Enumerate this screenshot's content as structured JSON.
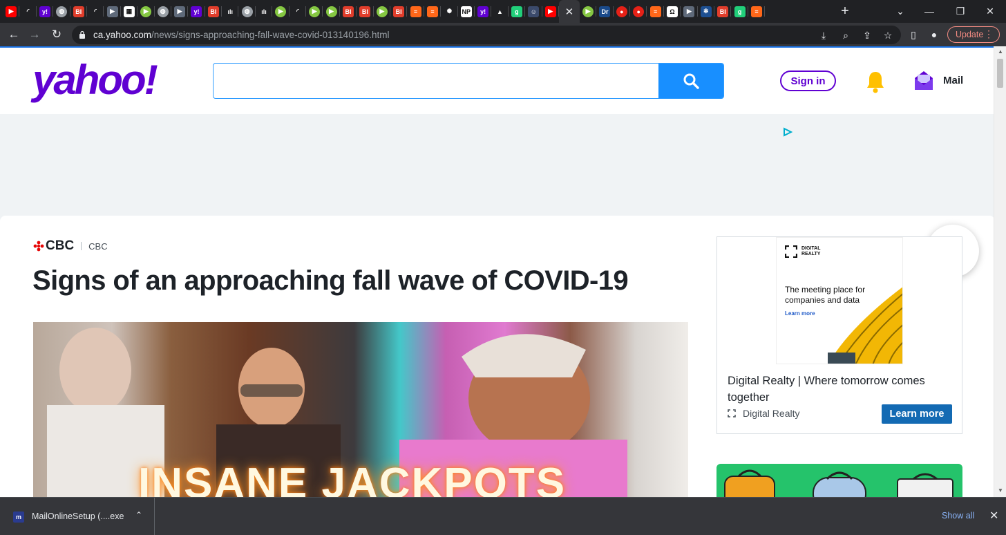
{
  "browser": {
    "tab_icons": [
      {
        "icon": "youtube-icon",
        "bg": "#ff0000",
        "glyph": "▶",
        "circle": false
      },
      {
        "icon": "shield-icon",
        "bg": "#202124",
        "glyph": "◜",
        "circle": false
      },
      {
        "icon": "yahoo-icon",
        "bg": "#6001d2",
        "glyph": "y!",
        "circle": false
      },
      {
        "icon": "globe-icon",
        "bg": "#9aa0a6",
        "glyph": "◍",
        "circle": true
      },
      {
        "icon": "business-insider-icon",
        "bg": "#e13d2b",
        "glyph": "BI",
        "circle": false
      },
      {
        "icon": "shield-icon",
        "bg": "#202124",
        "glyph": "◜",
        "circle": false
      },
      {
        "icon": "arrow-icon",
        "bg": "#5f6a7a",
        "glyph": "▶",
        "circle": false
      },
      {
        "icon": "grid-icon",
        "bg": "#ffffff",
        "glyph": "▦",
        "circle": false
      },
      {
        "icon": "rumble-icon",
        "bg": "#85c742",
        "glyph": "▶",
        "circle": true
      },
      {
        "icon": "globe-icon",
        "bg": "#9aa0a6",
        "glyph": "◍",
        "circle": true
      },
      {
        "icon": "arrow-icon",
        "bg": "#5f6a7a",
        "glyph": "▶",
        "circle": false
      },
      {
        "icon": "yahoo-icon",
        "bg": "#6001d2",
        "glyph": "y!",
        "circle": false
      },
      {
        "icon": "business-insider-icon",
        "bg": "#e13d2b",
        "glyph": "BI",
        "circle": false
      },
      {
        "icon": "bars-icon",
        "bg": "#202124",
        "glyph": "ılı",
        "circle": false
      },
      {
        "icon": "globe-icon",
        "bg": "#9aa0a6",
        "glyph": "◍",
        "circle": true
      },
      {
        "icon": "bars-icon",
        "bg": "#202124",
        "glyph": "ılı",
        "circle": false
      },
      {
        "icon": "rumble-icon",
        "bg": "#85c742",
        "glyph": "▶",
        "circle": true
      },
      {
        "icon": "shield-icon",
        "bg": "#202124",
        "glyph": "◜",
        "circle": false
      },
      {
        "icon": "rumble-icon",
        "bg": "#85c742",
        "glyph": "▶",
        "circle": true
      },
      {
        "icon": "rumble-icon",
        "bg": "#85c742",
        "glyph": "▶",
        "circle": true
      },
      {
        "icon": "business-insider-icon",
        "bg": "#e13d2b",
        "glyph": "BI",
        "circle": false
      },
      {
        "icon": "business-insider-icon",
        "bg": "#e13d2b",
        "glyph": "BI",
        "circle": false
      },
      {
        "icon": "rumble-icon",
        "bg": "#85c742",
        "glyph": "▶",
        "circle": true
      },
      {
        "icon": "business-insider-icon",
        "bg": "#e13d2b",
        "glyph": "BI",
        "circle": false
      },
      {
        "icon": "substack-icon",
        "bg": "#ff6719",
        "glyph": "≡",
        "circle": false
      },
      {
        "icon": "substack-icon",
        "bg": "#ff6719",
        "glyph": "≡",
        "circle": false
      },
      {
        "icon": "burst-icon",
        "bg": "#202124",
        "glyph": "✺",
        "circle": false
      },
      {
        "icon": "news-icon",
        "bg": "#ffffff",
        "glyph": "NP",
        "circle": false
      },
      {
        "icon": "yahoo-icon",
        "bg": "#6001d2",
        "glyph": "y!",
        "circle": false
      },
      {
        "icon": "mountain-icon",
        "bg": "#202124",
        "glyph": "▲",
        "circle": false
      },
      {
        "icon": "gab-icon",
        "bg": "#21cf7a",
        "glyph": "g",
        "circle": false
      },
      {
        "icon": "portrait-icon",
        "bg": "#3b4a6b",
        "glyph": "☺",
        "circle": false
      },
      {
        "icon": "youtube-icon",
        "bg": "#ff0000",
        "glyph": "▶",
        "circle": false
      }
    ],
    "tab_icons_after": [
      {
        "icon": "rumble-icon",
        "bg": "#85c742",
        "glyph": "▶",
        "circle": true
      },
      {
        "icon": "drudge-icon",
        "bg": "#1a4a8a",
        "glyph": "Dr",
        "circle": false
      },
      {
        "icon": "podcast-icon",
        "bg": "#e62117",
        "glyph": "●",
        "circle": true
      },
      {
        "icon": "podcast-icon",
        "bg": "#e62117",
        "glyph": "●",
        "circle": true
      },
      {
        "icon": "substack-icon",
        "bg": "#ff6719",
        "glyph": "≡",
        "circle": false
      },
      {
        "icon": "epoch-icon",
        "bg": "#ffffff",
        "glyph": "Ω",
        "circle": false
      },
      {
        "icon": "arrow-icon",
        "bg": "#5f6a7a",
        "glyph": "▶",
        "circle": false
      },
      {
        "icon": "snowflake-icon",
        "bg": "#1d4f91",
        "glyph": "✻",
        "circle": false
      },
      {
        "icon": "business-insider-icon",
        "bg": "#e13d2b",
        "glyph": "BI",
        "circle": false
      },
      {
        "icon": "gab-icon",
        "bg": "#21cf7a",
        "glyph": "g",
        "circle": false
      },
      {
        "icon": "substack-icon",
        "bg": "#ff6719",
        "glyph": "≡",
        "circle": false
      }
    ],
    "url_host": "ca.yahoo.com",
    "url_path": "/news/signs-approaching-fall-wave-covid-013140196.html",
    "update_label": "Update",
    "accent_color": "#1a73e8"
  },
  "header": {
    "logo_text": "yahoo!",
    "search_placeholder": "",
    "signin_label": "Sign in",
    "mail_label": "Mail",
    "brand_color": "#6001d2"
  },
  "article": {
    "source_logo": "CBC",
    "source_name": "CBC",
    "headline": "Signs of an approaching fall wave of COVID-19",
    "video_text": "INSANE JACKPOTS"
  },
  "ad": {
    "brand": [
      "DIGITAL",
      "REALTY"
    ],
    "tagline": "The meeting place for companies and data",
    "learn_small": "Learn more",
    "title": "Digital Realty | Where tomorrow comes together",
    "sponsor": "Digital Realty",
    "cta": "Learn more"
  },
  "downloads": {
    "file_name": "MailOnlineSetup (....exe",
    "show_all": "Show all"
  }
}
